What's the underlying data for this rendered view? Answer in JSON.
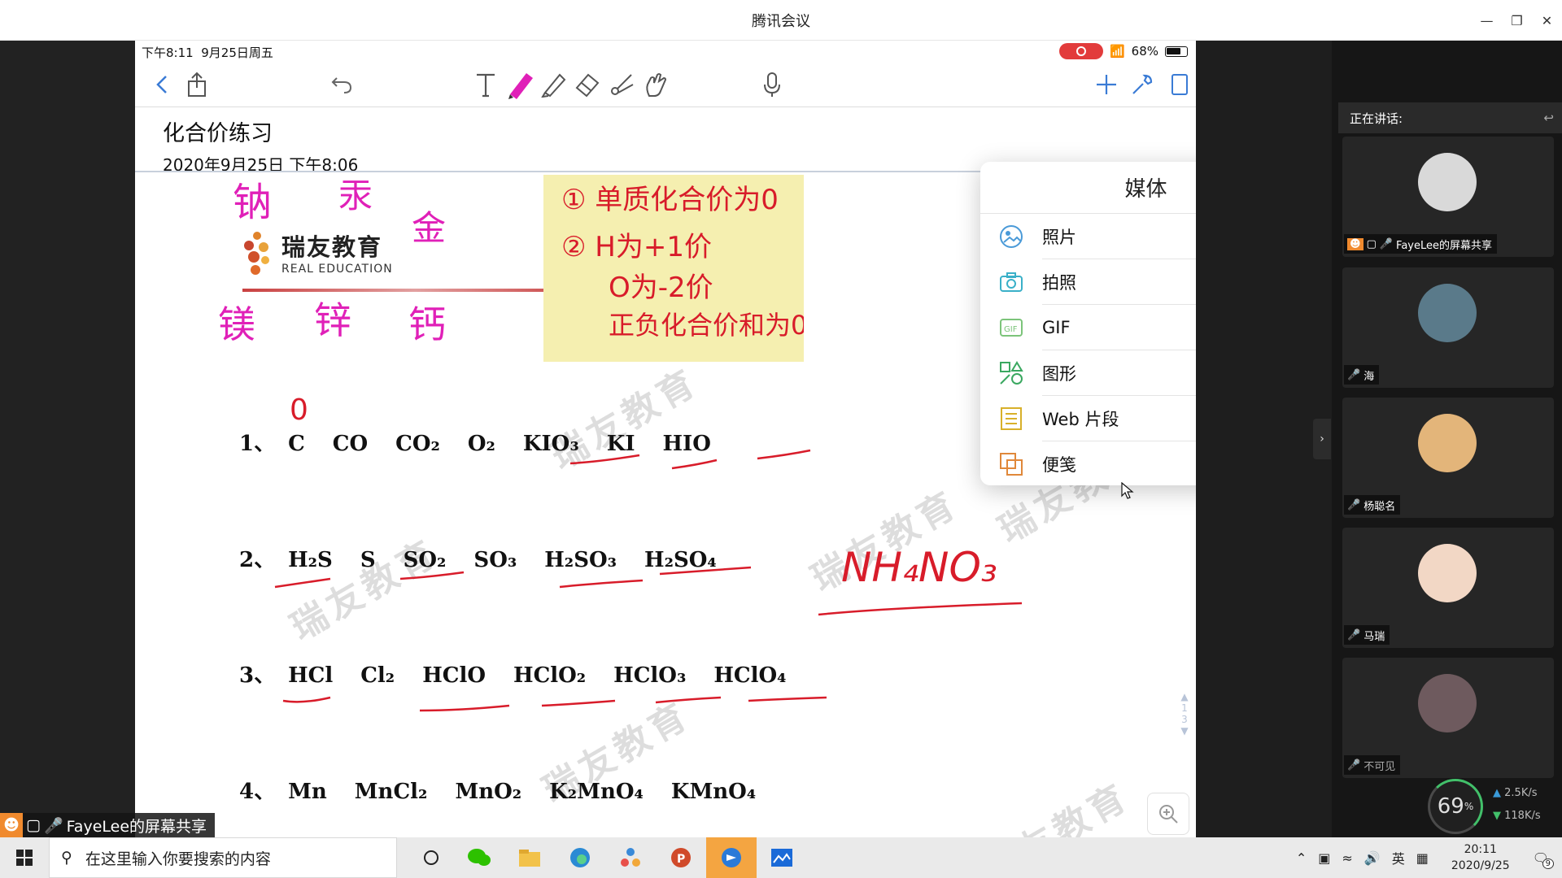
{
  "window": {
    "title": "腾讯会议"
  },
  "status": {
    "time": "下午8:11",
    "date": "9月25日周五",
    "battery": "68%"
  },
  "note": {
    "title": "化合价练习",
    "date": "2020年9月25日 下午8:06"
  },
  "logo": {
    "name": "瑞友教育",
    "sub": "REAL  EDUCATION"
  },
  "exercises": {
    "row1": [
      "1、",
      "C",
      "CO",
      "CO₂",
      "O₂",
      "KIO₃",
      "KI",
      "HIO"
    ],
    "row2": [
      "2、",
      "H₂S",
      "S",
      "SO₂",
      "SO₃",
      "H₂SO₃",
      "H₂SO₄"
    ],
    "row3": [
      "3、",
      "HCl",
      "Cl₂",
      "HClO",
      "HClO₂",
      "HClO₃",
      "HClO₄"
    ],
    "row4": [
      "4、",
      "Mn",
      "MnCl₂",
      "MnO₂",
      "K₂MnO₄",
      "KMnO₄"
    ]
  },
  "handwriting": {
    "magenta_top": [
      "钠",
      "汞",
      "金"
    ],
    "magenta_mid": [
      "镁",
      "锌",
      "钙"
    ],
    "sticky_lines": [
      "① 单质化合价为0",
      "② H为+1价",
      "O为-2价",
      "正负化合价和为0"
    ],
    "zero_mark": "0",
    "formula": "NH₄NO₃"
  },
  "page_nav": {
    "current": "1",
    "total": "3"
  },
  "popover": {
    "title": "媒体",
    "items": [
      {
        "label": "照片",
        "icon": "photos-icon"
      },
      {
        "label": "拍照",
        "icon": "camera-icon"
      },
      {
        "label": "GIF",
        "icon": "gif-icon"
      },
      {
        "label": "图形",
        "icon": "shapes-icon"
      },
      {
        "label": "Web 片段",
        "icon": "web-clip-icon"
      },
      {
        "label": "便笺",
        "icon": "sticky-note-icon"
      }
    ]
  },
  "meeting": {
    "speaking_label": "正在讲话:",
    "participants": [
      {
        "name": "FayeLee的屏幕共享",
        "avatar_color": "#d9d9d9"
      },
      {
        "name": "海",
        "avatar_color": "#5a7a8a"
      },
      {
        "name": "杨聪名",
        "avatar_color": "#e3b57a"
      },
      {
        "name": "马瑞",
        "avatar_color": "#f2d7c5"
      },
      {
        "name": "不可见",
        "avatar_color": "#6e5a5e"
      }
    ],
    "network": {
      "percent": "69",
      "unit": "%",
      "up": "2.5K/s",
      "down": "118K/s"
    }
  },
  "share_badge": "FayeLee的屏幕共享",
  "taskbar": {
    "search_placeholder": "在这里输入你要搜索的内容",
    "ime": "英",
    "clock_time": "20:11",
    "clock_date": "2020/9/25",
    "notif_count": "9"
  },
  "watermark": "瑞友教育",
  "colors": {
    "ink_red": "#d81c2a",
    "ink_magenta": "#e020b8",
    "sticky": "#f5efb0",
    "accent_orange": "#f4a541"
  }
}
